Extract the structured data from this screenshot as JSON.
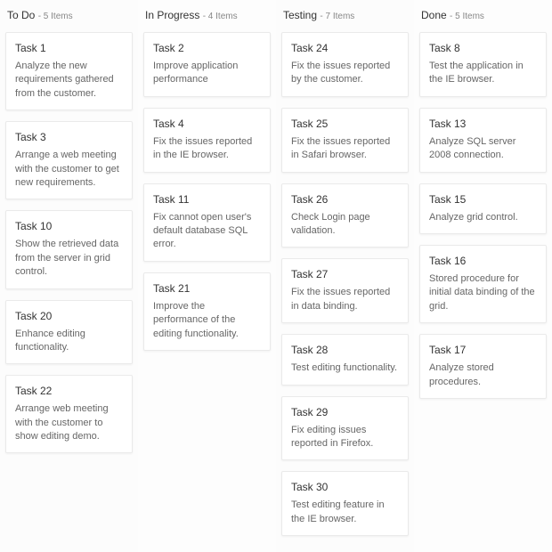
{
  "columns": [
    {
      "title": "To Do",
      "count_label": "- 5 Items",
      "cards": [
        {
          "title": "Task 1",
          "desc": "Analyze the new requirements gathered from the customer."
        },
        {
          "title": "Task 3",
          "desc": "Arrange a web meeting with the customer to get new requirements."
        },
        {
          "title": "Task 10",
          "desc": "Show the retrieved data from the server in grid control."
        },
        {
          "title": "Task 20",
          "desc": "Enhance editing functionality."
        },
        {
          "title": "Task 22",
          "desc": "Arrange web meeting with the customer to show editing demo."
        }
      ]
    },
    {
      "title": "In Progress",
      "count_label": "- 4 Items",
      "cards": [
        {
          "title": "Task 2",
          "desc": "Improve application performance"
        },
        {
          "title": "Task 4",
          "desc": "Fix the issues reported in the IE browser."
        },
        {
          "title": "Task 11",
          "desc": "Fix cannot open user's default database SQL error."
        },
        {
          "title": "Task 21",
          "desc": "Improve the performance of the editing functionality."
        }
      ]
    },
    {
      "title": "Testing",
      "count_label": "- 7 Items",
      "cards": [
        {
          "title": "Task 24",
          "desc": "Fix the issues reported by the customer."
        },
        {
          "title": "Task 25",
          "desc": "Fix the issues reported in Safari browser."
        },
        {
          "title": "Task 26",
          "desc": "Check Login page validation."
        },
        {
          "title": "Task 27",
          "desc": "Fix the issues reported in data binding."
        },
        {
          "title": "Task 28",
          "desc": "Test editing functionality."
        },
        {
          "title": "Task 29",
          "desc": "Fix editing issues reported in Firefox."
        },
        {
          "title": "Task 30",
          "desc": "Test editing feature in the IE browser."
        }
      ]
    },
    {
      "title": "Done",
      "count_label": "- 5 Items",
      "cards": [
        {
          "title": "Task 8",
          "desc": "Test the application in the IE browser."
        },
        {
          "title": "Task 13",
          "desc": "Analyze SQL server 2008 connection."
        },
        {
          "title": "Task 15",
          "desc": "Analyze grid control."
        },
        {
          "title": "Task 16",
          "desc": "Stored procedure for initial data binding of the grid."
        },
        {
          "title": "Task 17",
          "desc": "Analyze stored procedures."
        }
      ]
    }
  ]
}
